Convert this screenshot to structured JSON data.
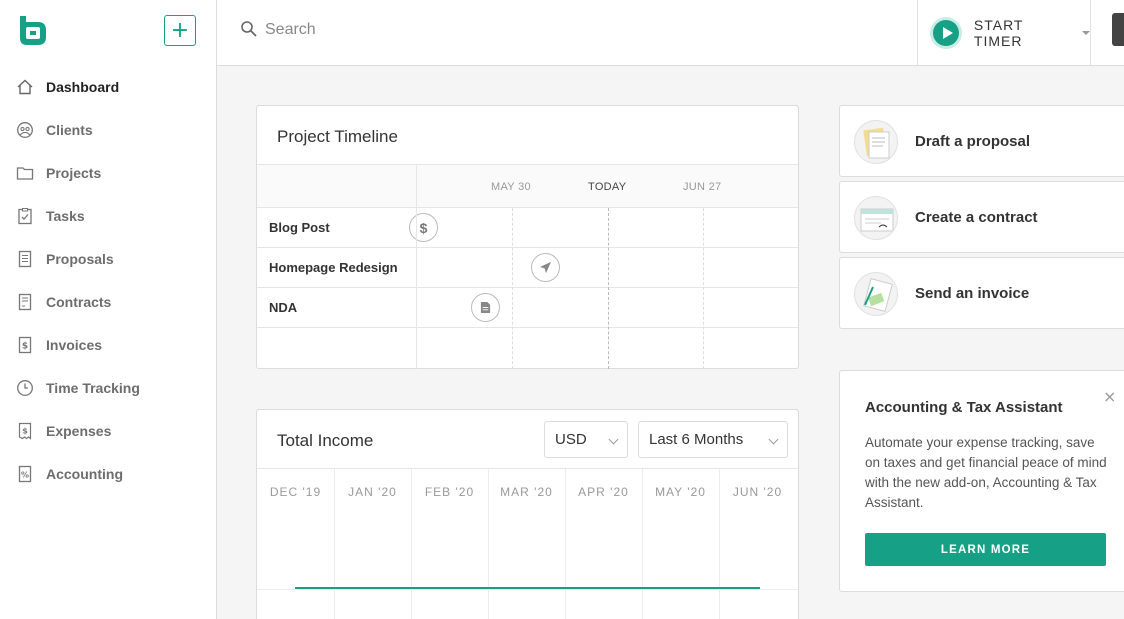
{
  "search": {
    "placeholder": "Search"
  },
  "timer": {
    "label": "START TIMER"
  },
  "sidebar": {
    "add_label": "+",
    "items": [
      {
        "label": "Dashboard",
        "icon": "home-icon"
      },
      {
        "label": "Clients",
        "icon": "clients-icon"
      },
      {
        "label": "Projects",
        "icon": "folder-icon"
      },
      {
        "label": "Tasks",
        "icon": "clipboard-check-icon"
      },
      {
        "label": "Proposals",
        "icon": "document-icon"
      },
      {
        "label": "Contracts",
        "icon": "contract-icon"
      },
      {
        "label": "Invoices",
        "icon": "invoice-dollar-icon"
      },
      {
        "label": "Time Tracking",
        "icon": "clock-icon"
      },
      {
        "label": "Expenses",
        "icon": "receipt-icon"
      },
      {
        "label": "Accounting",
        "icon": "percent-document-icon"
      }
    ]
  },
  "timeline": {
    "title": "Project Timeline",
    "dates": [
      "MAY 30",
      "TODAY",
      "JUN 27"
    ],
    "rows": [
      {
        "label": "Blog Post",
        "marker": "dollar-icon",
        "marker_text": "$"
      },
      {
        "label": "Homepage Redesign",
        "marker": "send-icon"
      },
      {
        "label": "NDA",
        "marker": "document-icon"
      }
    ]
  },
  "income": {
    "title": "Total Income",
    "currency": "USD",
    "range": "Last 6 Months",
    "months": [
      "DEC '19",
      "JAN '20",
      "FEB '20",
      "MAR '20",
      "APR '20",
      "MAY '20",
      "JUN '20"
    ]
  },
  "actions": [
    {
      "label": "Draft a proposal"
    },
    {
      "label": "Create a contract"
    },
    {
      "label": "Send an invoice"
    }
  ],
  "promo": {
    "title": "Accounting & Tax Assistant",
    "body": "Automate your expense tracking, save on taxes and get financial peace of mind with the new add-on, Accounting & Tax Assistant.",
    "button": "LEARN MORE",
    "close": "×"
  },
  "colors": {
    "accent": "#16a085"
  }
}
